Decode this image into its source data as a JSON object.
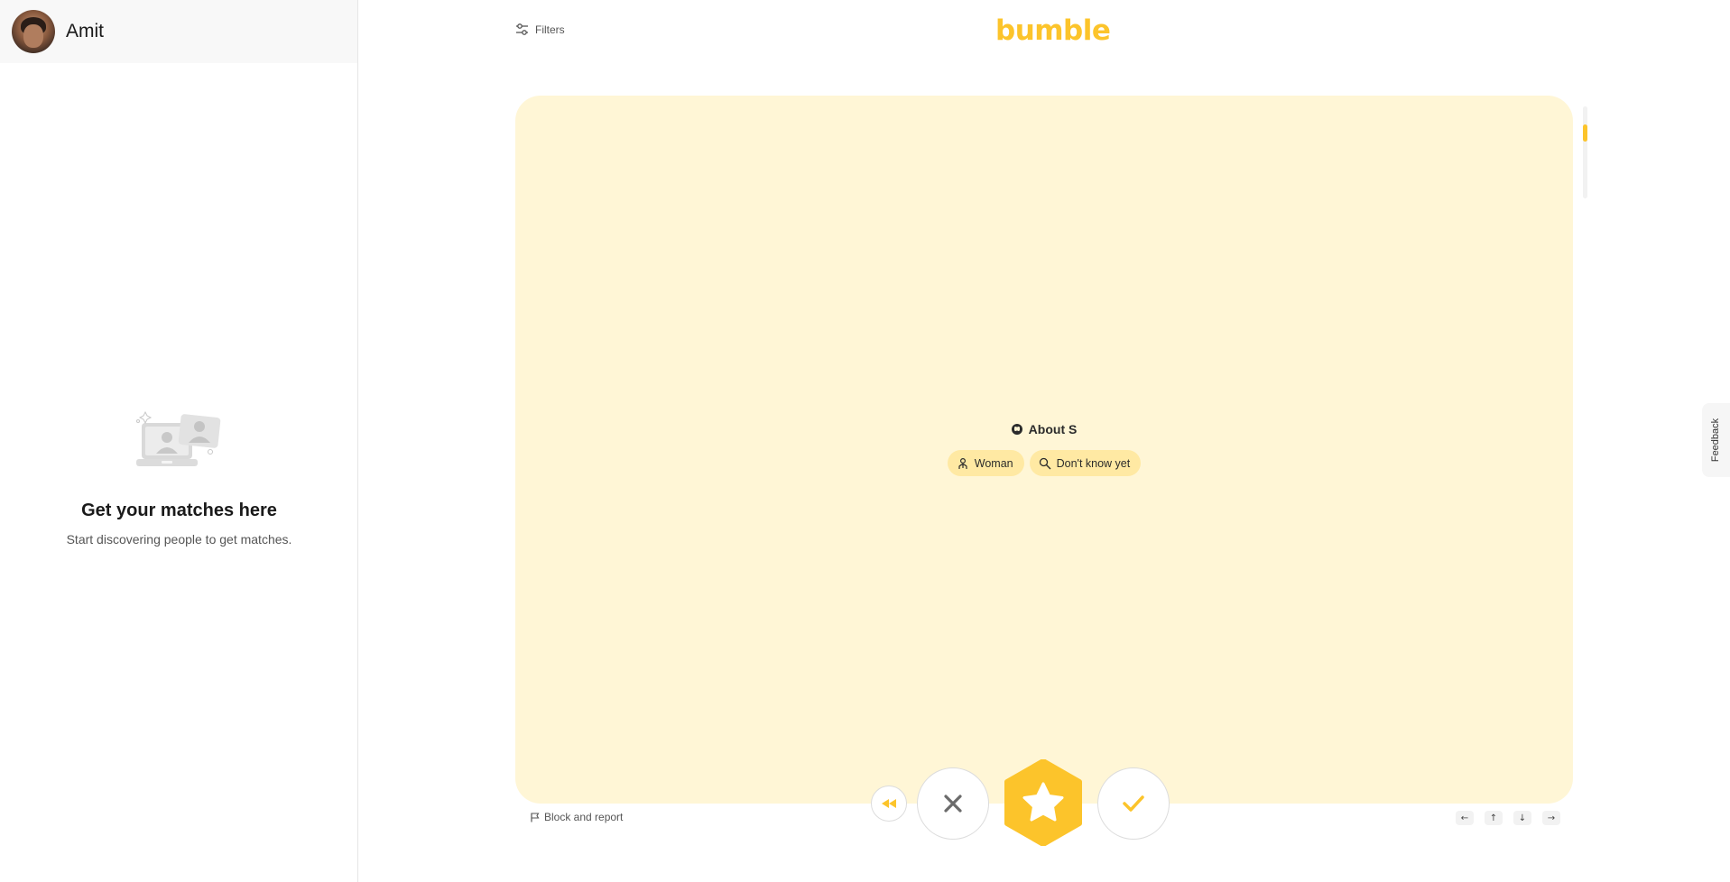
{
  "sidebar": {
    "user_name": "Amit",
    "empty_title": "Get your matches here",
    "empty_subtitle": "Start discovering people to get matches."
  },
  "header": {
    "filters_label": "Filters",
    "logo_text": "bumble"
  },
  "profile": {
    "about_title": "About S",
    "chips": [
      {
        "icon": "gender-icon",
        "label": "Woman"
      },
      {
        "icon": "search-icon",
        "label": "Don't know yet"
      }
    ],
    "photo_progress": 0.2
  },
  "actions": {
    "undo": "rewind-icon",
    "pass": "close-icon",
    "superswipe": "star-icon",
    "like": "check-icon"
  },
  "footer": {
    "block_report_label": "Block and report",
    "keyboard_hints": [
      "←",
      "↑",
      "↓",
      "→"
    ]
  },
  "feedback_label": "Feedback",
  "colors": {
    "brand": "#fcc42b",
    "card_bg": "#fff6d6",
    "chip_bg": "#ffe9a3"
  }
}
